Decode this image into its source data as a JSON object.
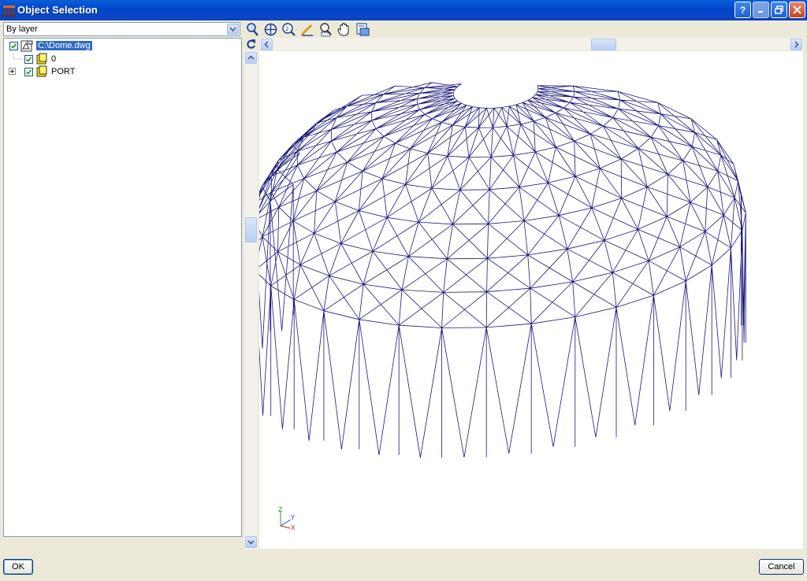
{
  "window": {
    "title": "Object Selection",
    "controls": [
      "help-icon",
      "minimize-icon",
      "restore-icon",
      "close-icon"
    ]
  },
  "filter": {
    "selected": "By layer"
  },
  "tree": {
    "root": {
      "label": "C:\\Dome.dwg",
      "checked": true,
      "selected": true
    },
    "children": [
      {
        "label": "0",
        "checked": true,
        "expandable": false
      },
      {
        "label": "PORT",
        "checked": true,
        "expandable": true
      }
    ]
  },
  "toolbar": {
    "tools": [
      "zoom-realtime-icon",
      "zoom-extents-icon",
      "zoom-2x-icon",
      "pick-icon",
      "zoom-window-icon",
      "pan-hand-icon",
      "view-options-icon"
    ]
  },
  "viewport": {
    "wire_color": "#1a1a7a",
    "axis_labels": {
      "x": "X",
      "y": "Y",
      "z": "Z"
    }
  },
  "buttons": {
    "ok": "OK",
    "cancel": "Cancel"
  }
}
